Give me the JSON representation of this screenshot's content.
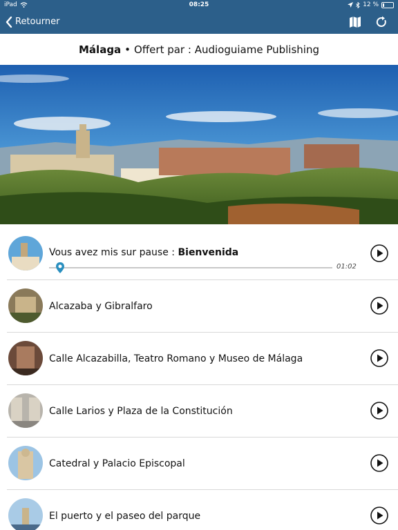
{
  "status_bar": {
    "device": "iPad",
    "time": "08:25",
    "battery": "12 %"
  },
  "nav": {
    "back_label": "Retourner",
    "map_icon": "map-icon",
    "refresh_icon": "refresh-icon"
  },
  "header": {
    "city": "Málaga",
    "separator": "•",
    "offered_by": "Offert par : Audioguiame Publishing"
  },
  "now_playing": {
    "prefix": "Vous avez mis sur pause : ",
    "title": "Bienvenida",
    "time": "01:02",
    "progress": 0.04
  },
  "items": [
    {
      "label": "Alcazaba y Gibralfaro"
    },
    {
      "label": "Calle Alcazabilla, Teatro Romano y Museo de Málaga"
    },
    {
      "label": "Calle Larios y Plaza de la Constitución"
    },
    {
      "label": "Catedral y Palacio Episcopal"
    },
    {
      "label": "El puerto y el paseo del parque"
    }
  ],
  "colors": {
    "nav_bg": "#2c5f8a",
    "accent": "#2a8fbf"
  }
}
